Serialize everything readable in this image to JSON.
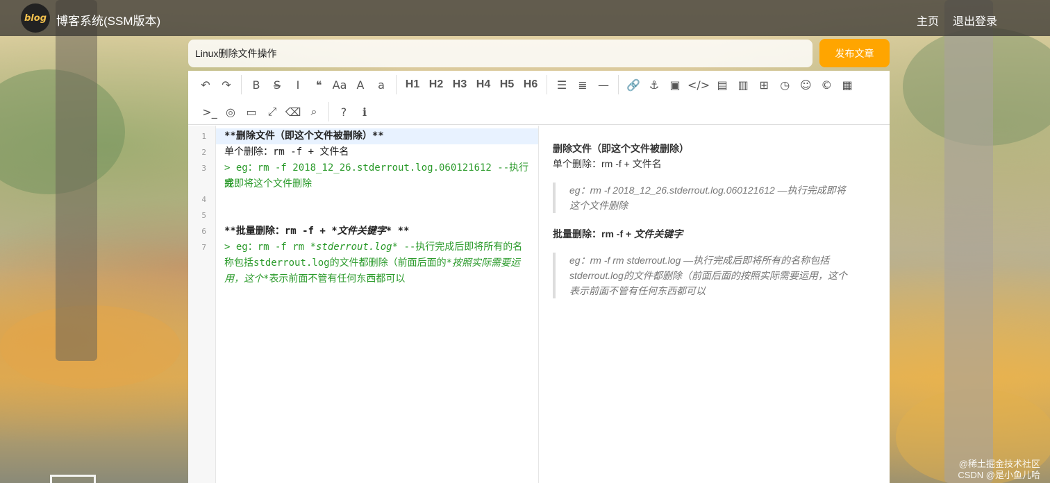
{
  "header": {
    "logo_text": "blog",
    "site_title": "博客系统(SSM版本)",
    "nav": {
      "home": "主页",
      "logout": "退出登录"
    }
  },
  "article": {
    "title_value": "Linux删除文件操作",
    "publish_label": "发布文章"
  },
  "toolbar": {
    "row1": [
      {
        "name": "undo-icon",
        "glyph": "↶"
      },
      {
        "name": "redo-icon",
        "glyph": "↷"
      },
      {
        "sep": true
      },
      {
        "name": "bold-icon",
        "glyph": "B"
      },
      {
        "name": "strikethrough-icon",
        "glyph": "S̶"
      },
      {
        "name": "italic-icon",
        "glyph": "I"
      },
      {
        "name": "quote-icon",
        "glyph": "❝"
      },
      {
        "name": "case-aa-icon",
        "glyph": "Aa"
      },
      {
        "name": "uppercase-icon",
        "glyph": "A"
      },
      {
        "name": "lowercase-icon",
        "glyph": "a"
      },
      {
        "sep": true
      },
      {
        "name": "h1-button",
        "glyph": "H1",
        "hd": true
      },
      {
        "name": "h2-button",
        "glyph": "H2",
        "hd": true
      },
      {
        "name": "h3-button",
        "glyph": "H3",
        "hd": true
      },
      {
        "name": "h4-button",
        "glyph": "H4",
        "hd": true
      },
      {
        "name": "h5-button",
        "glyph": "H5",
        "hd": true
      },
      {
        "name": "h6-button",
        "glyph": "H6",
        "hd": true
      },
      {
        "sep": true
      },
      {
        "name": "unordered-list-icon",
        "glyph": "☰"
      },
      {
        "name": "ordered-list-icon",
        "glyph": "≣"
      },
      {
        "name": "horizontal-rule-icon",
        "glyph": "—"
      },
      {
        "sep": true
      },
      {
        "name": "link-icon",
        "glyph": "🔗"
      },
      {
        "name": "anchor-icon",
        "glyph": "⚓"
      },
      {
        "name": "image-icon",
        "glyph": "▣"
      },
      {
        "name": "inline-code-icon",
        "glyph": "</>"
      },
      {
        "name": "code-block-icon",
        "glyph": "▤"
      },
      {
        "name": "preformatted-icon",
        "glyph": "▥"
      },
      {
        "name": "table-icon",
        "glyph": "⊞"
      },
      {
        "name": "datetime-icon",
        "glyph": "◷"
      },
      {
        "name": "emoji-icon",
        "glyph": "☺"
      },
      {
        "name": "html-entities-icon",
        "glyph": "©"
      },
      {
        "name": "pagebreak-icon",
        "glyph": "▦"
      }
    ],
    "row2": [
      {
        "name": "goto-line-icon",
        "glyph": ">_"
      },
      {
        "name": "toggle-preview-icon",
        "glyph": "◎"
      },
      {
        "name": "fullscreen-preview-icon",
        "glyph": "▭"
      },
      {
        "name": "fullscreen-icon",
        "glyph": "⤢"
      },
      {
        "name": "clear-icon",
        "glyph": "⌫"
      },
      {
        "name": "search-icon",
        "glyph": "⌕"
      },
      {
        "sep": true
      },
      {
        "name": "help-icon",
        "glyph": "?"
      },
      {
        "name": "info-icon",
        "glyph": "ℹ"
      }
    ]
  },
  "editor": {
    "line_numbers": [
      "1",
      "2",
      "3",
      "4",
      "5",
      "6",
      "7"
    ],
    "lines": {
      "l1": "**删除文件（即这个文件被删除）**",
      "l2": "单个删除：rm -f + 文件名",
      "l3a": "> eg：rm -f  2018_12_26.stderrout.log.060121612 --执行完",
      "l3b": "成即将这个文件删除",
      "l6_pre": "**批量删除：rm -f + *",
      "l6_em": "文件关键字",
      "l6_post": "* **",
      "l7a_pre": "> eg：rm -f  rm ",
      "l7a_em": "*stderrout.log*",
      "l7a_post": "  --执行完成后即将所有的名",
      "l7b_pre": "称包括stderrout.log的文件都删除（前面后面的",
      "l7b_em": "*按照实际需要运",
      "l7c_em": "用，这个*",
      "l7c_post": "表示前面不管有任何东西都可以"
    }
  },
  "preview": {
    "h1": "删除文件（即这个文件被删除）",
    "p1": "单个删除：rm -f + 文件名",
    "q1a": "eg：rm -f 2018_12_26.stderrout.log.060121612 —执行完成即将",
    "q1b": "这个文件删除",
    "h2_pre": "批量删除：rm -f + ",
    "h2_em": "文件关键字",
    "q2a": "eg：rm -f rm stderrout.log —执行完成后即将所有的名称包括",
    "q2b": "stderrout.log的文件都删除（前面后面的按照实际需要运用，这个",
    "q2c": "表示前面不管有任何东西都可以"
  },
  "watermark": {
    "line1": "@稀土掘金技术社区",
    "line2": "CSDN @是小鱼儿哈"
  }
}
